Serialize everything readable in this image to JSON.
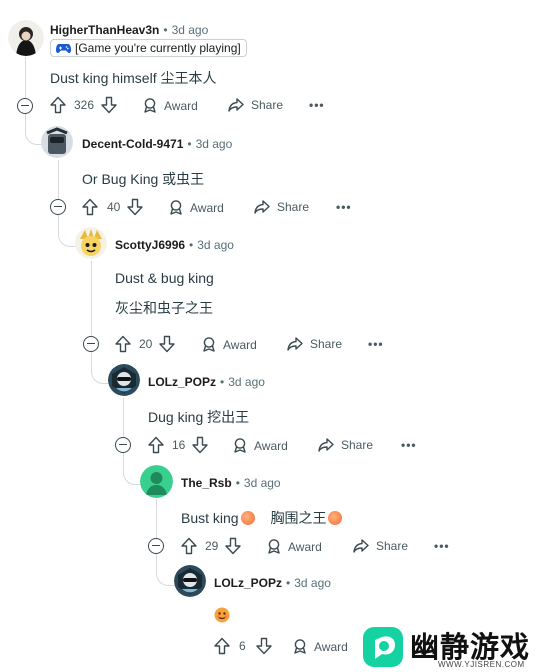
{
  "colors": {
    "logo_green": "#14d2a1",
    "accent_blue": "#1a5ad7",
    "peach": "#f26b3a"
  },
  "comments": [
    {
      "author": "HigherThanHeav3n",
      "time": "3d ago",
      "flair": "[Game you're currently playing]",
      "body": "Dust king himself   尘王本人",
      "votes": "326",
      "award": "Award",
      "share": "Share",
      "more": "•••"
    },
    {
      "author": "Decent-Cold-9471",
      "time": "3d ago",
      "body": "Or Bug King   或虫王",
      "votes": "40",
      "award": "Award",
      "share": "Share",
      "more": "•••"
    },
    {
      "author": "ScottyJ6996",
      "time": "3d ago",
      "body": "Dust & bug king",
      "body2": "灰尘和虫子之王",
      "votes": "20",
      "award": "Award",
      "share": "Share",
      "more": "•••"
    },
    {
      "author": "LOLz_POPz",
      "time": "3d ago",
      "body": "Dug king   挖出王",
      "votes": "16",
      "award": "Award",
      "share": "Share",
      "more": "•••"
    },
    {
      "author": "The_Rsb",
      "time": "3d ago",
      "body": "Bust king",
      "body_b": "胸围之王",
      "votes": "29",
      "award": "Award",
      "share": "Share",
      "more": "•••"
    },
    {
      "author": "LOLz_POPz",
      "time": "3d ago",
      "votes": "6",
      "award": "Award"
    }
  ],
  "watermark": {
    "title": "幽静游戏",
    "url": "WWW.YJISREN.COM"
  }
}
